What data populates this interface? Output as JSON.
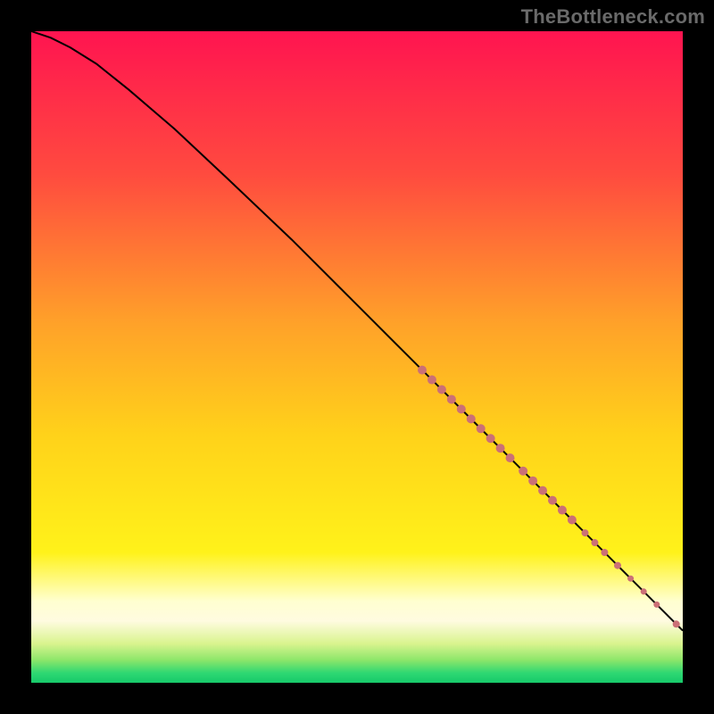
{
  "watermark": "TheBottleneck.com",
  "colors": {
    "frame": "#000000",
    "curve": "#000000",
    "dots": "#cb7076",
    "gradient_stops": [
      {
        "offset": 0.0,
        "color": "#ff1450"
      },
      {
        "offset": 0.22,
        "color": "#ff4b3f"
      },
      {
        "offset": 0.45,
        "color": "#ffa229"
      },
      {
        "offset": 0.62,
        "color": "#ffd21a"
      },
      {
        "offset": 0.8,
        "color": "#fff21a"
      },
      {
        "offset": 0.875,
        "color": "#ffffd0"
      },
      {
        "offset": 0.905,
        "color": "#fffbe0"
      },
      {
        "offset": 0.94,
        "color": "#d9f48e"
      },
      {
        "offset": 0.965,
        "color": "#8de66a"
      },
      {
        "offset": 0.985,
        "color": "#2ed872"
      },
      {
        "offset": 1.0,
        "color": "#17c96a"
      }
    ]
  },
  "chart_data": {
    "type": "line",
    "title": "",
    "xlabel": "",
    "ylabel": "",
    "xlim": [
      0,
      100
    ],
    "ylim": [
      0,
      100
    ],
    "series": [
      {
        "name": "curve",
        "x": [
          0,
          3,
          6,
          10,
          15,
          22,
          30,
          40,
          50,
          60,
          68,
          76,
          84,
          90,
          95,
          100
        ],
        "y": [
          100,
          99,
          97.5,
          95,
          91,
          85,
          77.5,
          68,
          58,
          48,
          40,
          32,
          24,
          18,
          13,
          8
        ]
      }
    ],
    "highlight_points": {
      "name": "dots",
      "points": [
        {
          "x": 60.0,
          "y": 48.0,
          "r": 5
        },
        {
          "x": 61.5,
          "y": 46.5,
          "r": 5
        },
        {
          "x": 63.0,
          "y": 45.0,
          "r": 5
        },
        {
          "x": 64.5,
          "y": 43.5,
          "r": 5
        },
        {
          "x": 66.0,
          "y": 42.0,
          "r": 5
        },
        {
          "x": 67.5,
          "y": 40.5,
          "r": 5
        },
        {
          "x": 69.0,
          "y": 39.0,
          "r": 5
        },
        {
          "x": 70.5,
          "y": 37.5,
          "r": 5
        },
        {
          "x": 72.0,
          "y": 36.0,
          "r": 5
        },
        {
          "x": 73.5,
          "y": 34.5,
          "r": 5
        },
        {
          "x": 75.5,
          "y": 32.5,
          "r": 5
        },
        {
          "x": 77.0,
          "y": 31.0,
          "r": 5
        },
        {
          "x": 78.5,
          "y": 29.5,
          "r": 5
        },
        {
          "x": 80.0,
          "y": 28.0,
          "r": 5
        },
        {
          "x": 81.5,
          "y": 26.5,
          "r": 5
        },
        {
          "x": 83.0,
          "y": 25.0,
          "r": 5
        },
        {
          "x": 85.0,
          "y": 23.0,
          "r": 4
        },
        {
          "x": 86.5,
          "y": 21.5,
          "r": 4
        },
        {
          "x": 88.0,
          "y": 20.0,
          "r": 4
        },
        {
          "x": 90.0,
          "y": 18.0,
          "r": 4
        },
        {
          "x": 92.0,
          "y": 16.0,
          "r": 3.5
        },
        {
          "x": 94.0,
          "y": 14.0,
          "r": 3.5
        },
        {
          "x": 96.0,
          "y": 12.0,
          "r": 3.5
        },
        {
          "x": 99.0,
          "y": 9.0,
          "r": 4
        }
      ]
    }
  }
}
